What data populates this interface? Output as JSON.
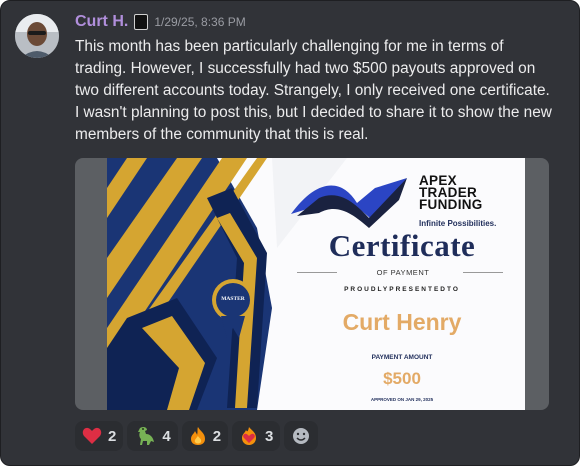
{
  "message": {
    "author": "Curt H.",
    "timestamp": "1/29/25, 8:36 PM",
    "text": "This month has been particularly challenging for me in terms of trading. However, I successfully had two $500 payouts approved on two different accounts today. Strangely, I only received one certificate. I wasn't planning to post this, but I decided to share it to show the new members of the community that this is real."
  },
  "certificate": {
    "brand_line1": "APEX",
    "brand_line2": "TRADER",
    "brand_line3": "FUNDING",
    "tagline": "Infinite Possibilities.",
    "title": "Certificate",
    "subtitle": "OF PAYMENT",
    "presented_to": "PROUDLYPRESENTEDTO",
    "recipient": "Curt Henry",
    "payment_label": "PAYMENT AMOUNT",
    "payment_amount": "$500",
    "approved": "APPROVED ON JAN 29, 2025",
    "badge_text": "MASTER",
    "colors": {
      "navy": "#1f2d5a",
      "gold": "#e3aa66",
      "blue_stripe": "#1a3575",
      "gold_stripe": "#d5a531"
    }
  },
  "reactions": [
    {
      "emoji": "red-heart",
      "count": "2"
    },
    {
      "emoji": "t-rex",
      "count": "4"
    },
    {
      "emoji": "fire",
      "count": "2"
    },
    {
      "emoji": "heart-on-fire",
      "count": "3"
    }
  ],
  "add_reaction_icon": "smiley-add-icon",
  "colors": {
    "background": "#313338",
    "username": "#b18fdc",
    "text": "#ececed",
    "pill": "#2b2d31"
  }
}
